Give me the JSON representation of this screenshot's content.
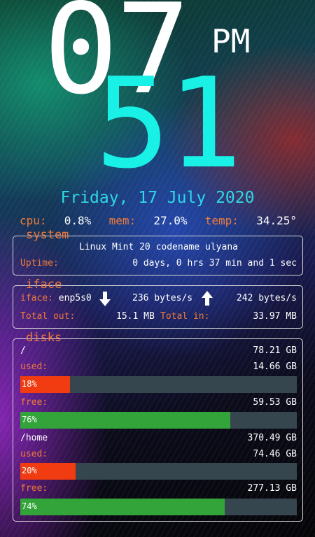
{
  "clock": {
    "hour": "07",
    "minute": "51",
    "ampm": "PM"
  },
  "date": "Friday, 17 July 2020",
  "stats": {
    "cpu_label": "cpu:",
    "cpu_value": "0.8%",
    "mem_label": "mem:",
    "mem_value": "27.0%",
    "temp_label": "temp:",
    "temp_value": "34.25°"
  },
  "system": {
    "title": "system",
    "os": "Linux Mint 20 codename ulyana",
    "uptime_label": "Uptime:",
    "uptime_value": "0 days, 0 hrs 37 min and 1 sec"
  },
  "iface": {
    "title": "iface",
    "iface_label": "iface:",
    "iface_name": "enp5s0",
    "down_speed": "236 bytes/s",
    "up_speed": "242 bytes/s",
    "total_out_label": "Total out:",
    "total_out": "15.1 MB",
    "total_in_label": "Total in:",
    "total_in": "33.97 MB",
    "down_icon": "arrow-down-icon",
    "up_icon": "arrow-up-icon"
  },
  "disks": {
    "title": "disks",
    "items": [
      {
        "mount": "/",
        "size": "78.21 GB",
        "used_label": "used:",
        "used": "14.66 GB",
        "used_pct": "18%",
        "used_fraction": 0.18,
        "free_label": "free:",
        "free": "59.53 GB",
        "free_pct": "76%",
        "free_fraction": 0.76
      },
      {
        "mount": "/home",
        "size": "370.49 GB",
        "used_label": "used:",
        "used": "74.46 GB",
        "used_pct": "20%",
        "used_fraction": 0.2,
        "free_label": "free:",
        "free": "277.13 GB",
        "free_pct": "74%",
        "free_fraction": 0.74
      }
    ]
  },
  "colors": {
    "label": "#ef7a3a",
    "minute": "#19f0e6",
    "date": "#2ed8e6",
    "used_bar": "#f03c10",
    "free_bar": "#33a43a",
    "bar_track": "#36464f"
  }
}
